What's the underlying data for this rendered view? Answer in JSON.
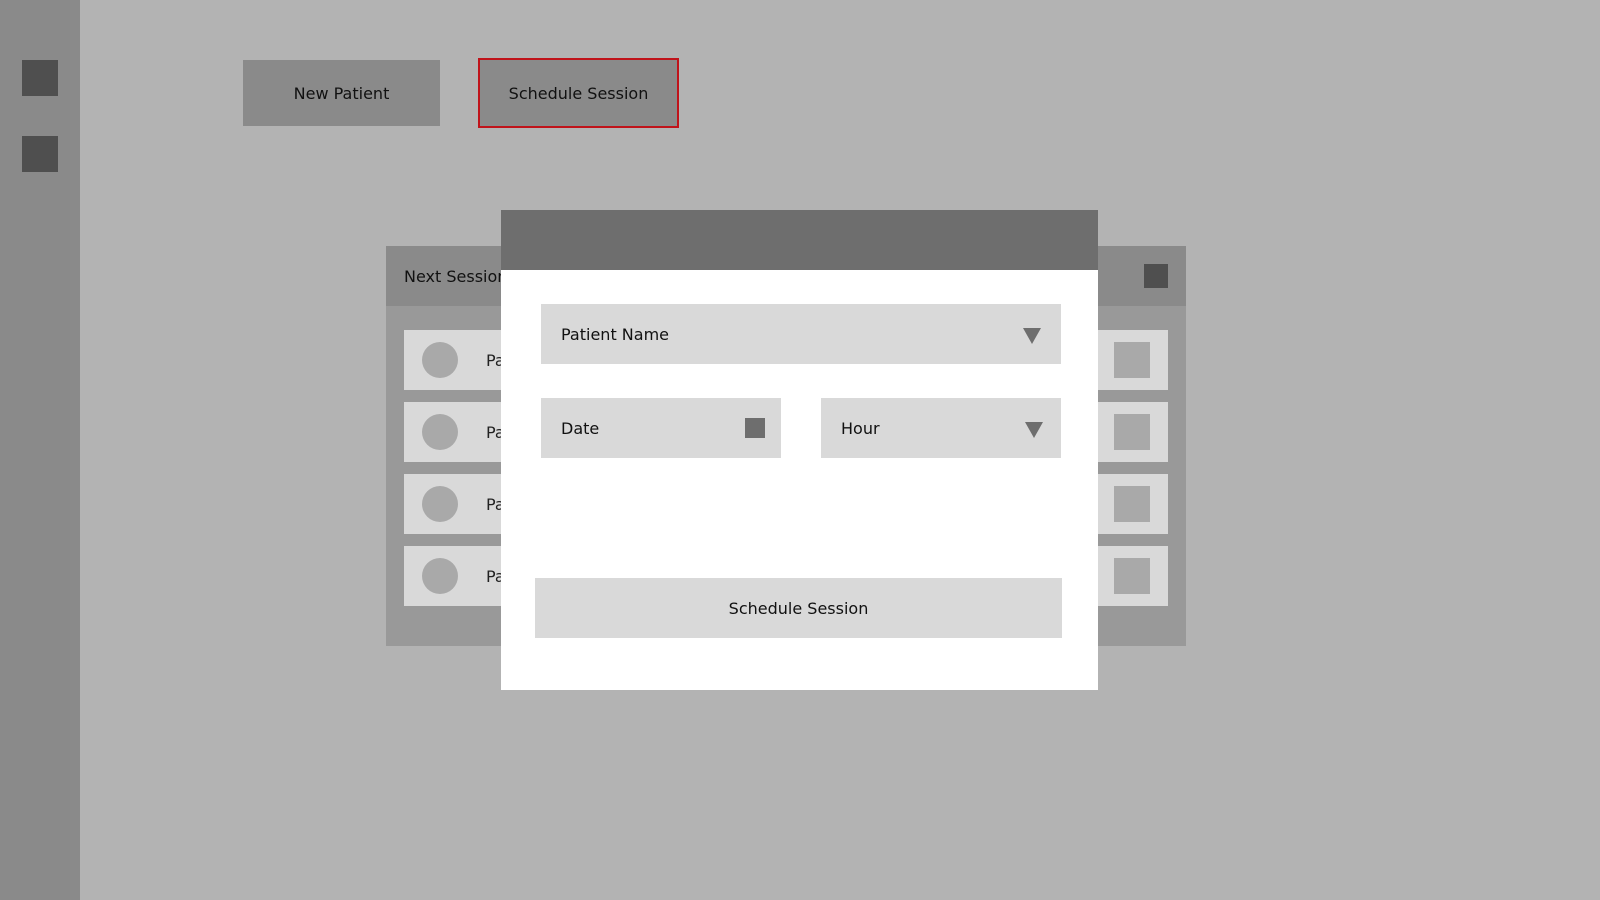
{
  "top_buttons": {
    "new_patient": "New Patient",
    "schedule_session": "Schedule Session"
  },
  "sessions_panel": {
    "title": "Next Sessions",
    "rows": [
      {
        "label": "Patient"
      },
      {
        "label": "Patient"
      },
      {
        "label": "Patient"
      },
      {
        "label": "Patient"
      }
    ]
  },
  "modal": {
    "patient_name": "Patient Name",
    "date": "Date",
    "hour": "Hour",
    "submit": "Schedule Session"
  },
  "colors": {
    "highlight": "#c0131a",
    "background": "#b3b3b3",
    "sidebar": "#8a8a8a"
  },
  "icons": {
    "sidebar": [
      "square-icon",
      "square-icon"
    ],
    "dropdown": "triangle-down-icon",
    "date": "calendar-icon",
    "avatar": "avatar-circle"
  }
}
